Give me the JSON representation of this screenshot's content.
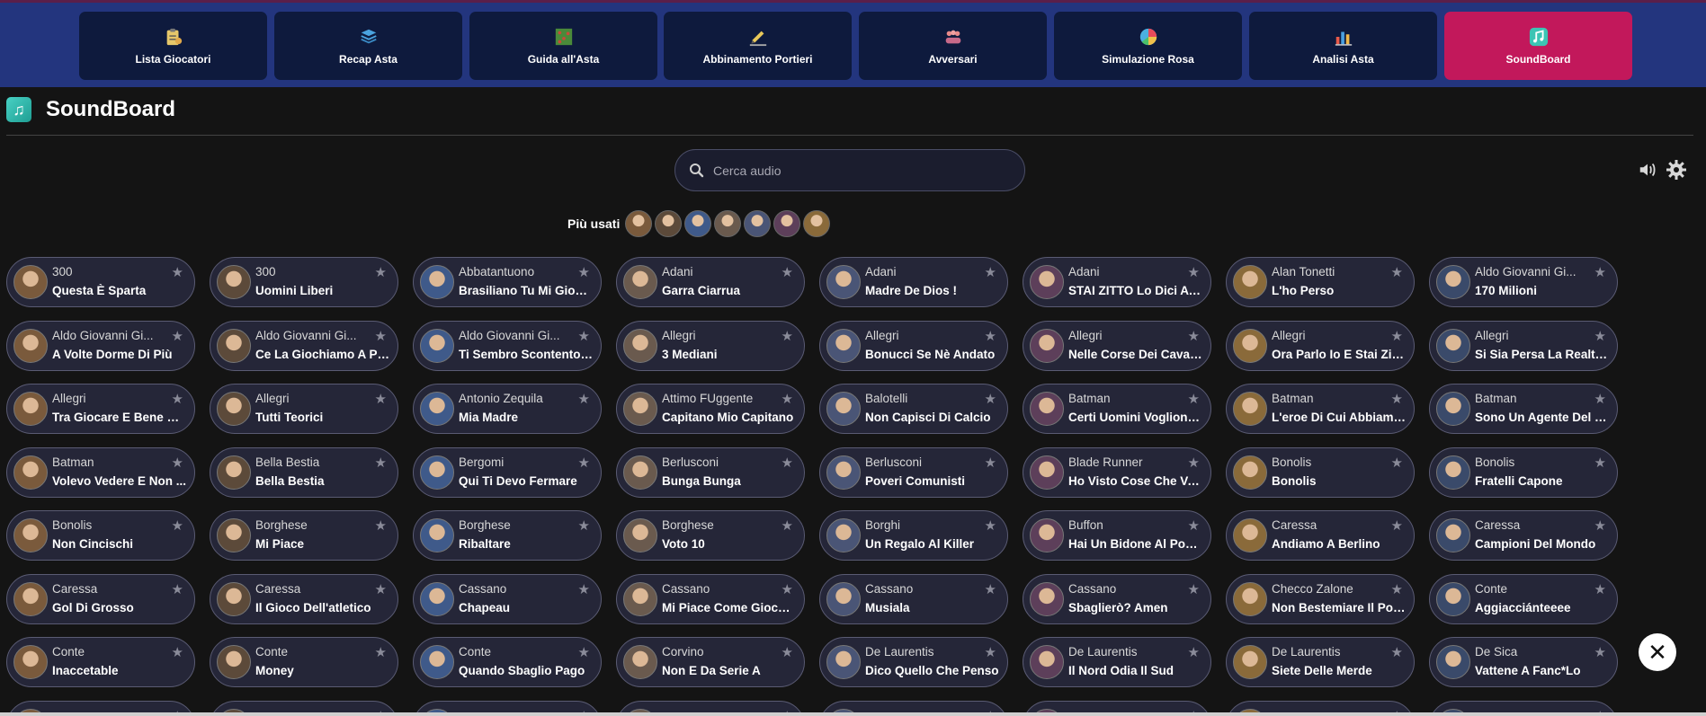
{
  "nav": {
    "items": [
      {
        "label": "Lista Giocatori",
        "icon": "clipboard-icon"
      },
      {
        "label": "Recap Asta",
        "icon": "stack-icon"
      },
      {
        "label": "Guida all'Asta",
        "icon": "field-map-icon"
      },
      {
        "label": "Abbinamento Portieri",
        "icon": "pencil-icon"
      },
      {
        "label": "Avversari",
        "icon": "group-icon"
      },
      {
        "label": "Simulazione Rosa",
        "icon": "pie-chart-icon"
      },
      {
        "label": "Analisi Asta",
        "icon": "bar-chart-icon"
      },
      {
        "label": "SoundBoard",
        "icon": "music-note-icon"
      }
    ],
    "active_index": 7,
    "active_color": "#c2185b"
  },
  "header": {
    "title": "SoundBoard"
  },
  "search": {
    "placeholder": "Cerca audio"
  },
  "frequent": {
    "label": "Più usati",
    "count": 7
  },
  "cards": [
    {
      "author": "300",
      "title": "Questa È Sparta"
    },
    {
      "author": "300",
      "title": "Uomini Liberi"
    },
    {
      "author": "Abbatantuono",
      "title": "Brasiliano Tu Mi Giochi..."
    },
    {
      "author": "Adani",
      "title": "Garra Ciarrua"
    },
    {
      "author": "Adani",
      "title": "Madre De Dios !"
    },
    {
      "author": "Adani",
      "title": "STAI ZITTO Lo Dici A T..."
    },
    {
      "author": "Alan Tonetti",
      "title": "L'ho Perso"
    },
    {
      "author": "Aldo Giovanni Gi...",
      "title": "170 Milioni"
    },
    {
      "author": "Aldo Giovanni Gi...",
      "title": "A Volte Dorme Di Più"
    },
    {
      "author": "Aldo Giovanni Gi...",
      "title": "Ce La Giochiamo A Pal..."
    },
    {
      "author": "Aldo Giovanni Gi...",
      "title": "Ti Sembro Scontento? ..."
    },
    {
      "author": "Allegri",
      "title": "3 Mediani"
    },
    {
      "author": "Allegri",
      "title": "Bonucci Se Nè Andato"
    },
    {
      "author": "Allegri",
      "title": "Nelle Corse Dei Cavalli..."
    },
    {
      "author": "Allegri",
      "title": "Ora Parlo Io E Stai Zitto"
    },
    {
      "author": "Allegri",
      "title": "Si Sia Persa La Realtà ..."
    },
    {
      "author": "Allegri",
      "title": "Tra Giocare E Bene E ..."
    },
    {
      "author": "Allegri",
      "title": "Tutti Teorici"
    },
    {
      "author": "Antonio Zequila",
      "title": "Mia Madre"
    },
    {
      "author": "Attimo FUggente",
      "title": "Capitano Mio Capitano"
    },
    {
      "author": "Balotelli",
      "title": "Non Capisci Di Calcio"
    },
    {
      "author": "Batman",
      "title": "Certi Uomini Vogliono ..."
    },
    {
      "author": "Batman",
      "title": "L'eroe Di Cui Abbiamo ..."
    },
    {
      "author": "Batman",
      "title": "Sono Un Agente Del C..."
    },
    {
      "author": "Batman",
      "title": "Volevo Vedere E Non ..."
    },
    {
      "author": "Bella Bestia",
      "title": "Bella Bestia"
    },
    {
      "author": "Bergomi",
      "title": "Qui Ti Devo Fermare"
    },
    {
      "author": "Berlusconi",
      "title": "Bunga Bunga"
    },
    {
      "author": "Berlusconi",
      "title": "Poveri Comunisti"
    },
    {
      "author": "Blade Runner",
      "title": "Ho Visto Cose Che Voi ..."
    },
    {
      "author": "Bonolis",
      "title": "Bonolis"
    },
    {
      "author": "Bonolis",
      "title": "Fratelli Capone"
    },
    {
      "author": "Bonolis",
      "title": "Non Cincischi"
    },
    {
      "author": "Borghese",
      "title": "Mi Piace"
    },
    {
      "author": "Borghese",
      "title": "Ribaltare"
    },
    {
      "author": "Borghese",
      "title": "Voto 10"
    },
    {
      "author": "Borghi",
      "title": "Un Regalo Al Killer"
    },
    {
      "author": "Buffon",
      "title": "Hai Un Bidone Al Posto..."
    },
    {
      "author": "Caressa",
      "title": "Andiamo A Berlino"
    },
    {
      "author": "Caressa",
      "title": "Campioni Del Mondo"
    },
    {
      "author": "Caressa",
      "title": "Gol Di Grosso"
    },
    {
      "author": "Caressa",
      "title": "Il Gioco Dell'atletico"
    },
    {
      "author": "Cassano",
      "title": "Chapeau"
    },
    {
      "author": "Cassano",
      "title": "Mi Piace Come Giocat..."
    },
    {
      "author": "Cassano",
      "title": "Musiala"
    },
    {
      "author": "Cassano",
      "title": "Sbaglierò? Amen"
    },
    {
      "author": "Checco Zalone",
      "title": "Non Bestemiare Il Post..."
    },
    {
      "author": "Conte",
      "title": "Aggiacciánteeee"
    },
    {
      "author": "Conte",
      "title": "Inaccetable"
    },
    {
      "author": "Conte",
      "title": "Money"
    },
    {
      "author": "Conte",
      "title": "Quando Sbaglio Pago"
    },
    {
      "author": "Corvino",
      "title": "Non E Da Serie A"
    },
    {
      "author": "De Laurentis",
      "title": "Dico Quello Che Penso"
    },
    {
      "author": "De Laurentis",
      "title": "Il Nord Odia Il Sud"
    },
    {
      "author": "De Laurentis",
      "title": "Siete Delle Merde"
    },
    {
      "author": "De Sica",
      "title": "Vattene A Fanc*Lo"
    },
    {
      "author": "",
      "title": ""
    },
    {
      "author": "",
      "title": ""
    },
    {
      "author": "",
      "title": ""
    },
    {
      "author": "",
      "title": ""
    },
    {
      "author": "",
      "title": ""
    },
    {
      "author": "",
      "title": ""
    },
    {
      "author": "",
      "title": ""
    },
    {
      "author": "",
      "title": ""
    }
  ],
  "avatar_colors": [
    "#7a5a3c",
    "#5c4a3a",
    "#3f5a8a",
    "#6a5a4e",
    "#4a5576",
    "#5d3f5a",
    "#8a6a3a",
    "#3a4a6a"
  ],
  "colors": {
    "background": "#141414",
    "nav_bar": "#23357e",
    "nav_button": "#0e1a3d",
    "card": "#252638"
  },
  "icons": {
    "search": "search-icon",
    "volume": "volume-icon",
    "settings": "gear-icon",
    "close": "close-icon",
    "star": "star-icon"
  }
}
